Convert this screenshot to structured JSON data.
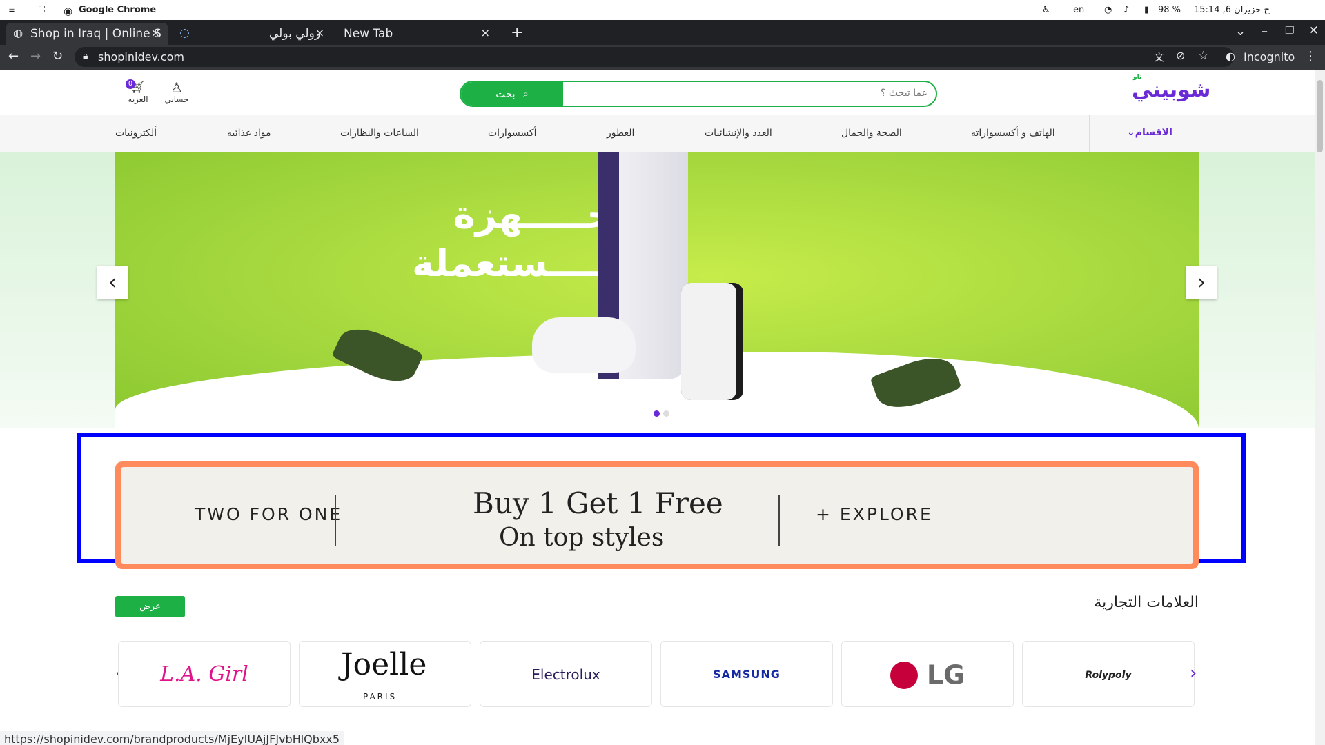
{
  "os": {
    "app_name": "Google Chrome",
    "lang": "en",
    "battery": "98 %",
    "datetime": "ح حزيران 6, 15:14"
  },
  "browser": {
    "tabs": [
      {
        "title": "Shop in Iraq | Online S"
      },
      {
        "title": "رولي بولي"
      },
      {
        "title": "New Tab"
      }
    ],
    "new_tab": "+",
    "url": "shopinidev.com",
    "profile": "Incognito",
    "status_url": "https://shopinidev.com/brandproducts/MjEyIUAjJFJvbHlQbxx5"
  },
  "header": {
    "logo_text": "شوبيني",
    "logo_sub": "ناو",
    "search_button": "بحث",
    "search_placeholder": "عما تبحث ؟",
    "account_label": "حسابي",
    "cart_label": "العربه",
    "cart_count": "0"
  },
  "categories": {
    "label": "الاقسام",
    "items": [
      "الهاتف و أكسسواراته",
      "الصحة والجمال",
      "العدد والإنشائيات",
      "العطور",
      "أكسسوارات",
      "الساعات والنظارات",
      "مواد غذائيه",
      "ألكترونيات"
    ]
  },
  "hero": {
    "line1": "الأجـــــهزة",
    "line2": "المـــــستعملة",
    "slides_total": 2,
    "active_slide": 1
  },
  "promo": {
    "left": "TWO FOR ONE",
    "title": "Buy 1 Get 1 Free",
    "subtitle": "On top styles",
    "right": "+ EXPLORE",
    "accent": "#ff8a5b"
  },
  "brands": {
    "title": "العلامات التجارية",
    "show_button": "عرض",
    "items": [
      "L.A. Girl",
      "Joelle",
      "Electrolux",
      "SAMSUNG",
      "LG",
      "Rolypoly"
    ],
    "joelle_sub": "PARIS"
  },
  "colors": {
    "brand_green": "#1cb045",
    "brand_purple": "#6a2bd6"
  }
}
